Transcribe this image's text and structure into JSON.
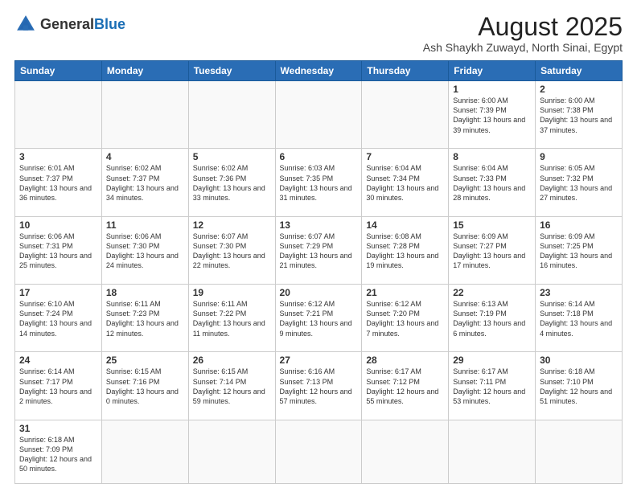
{
  "header": {
    "logo_general": "General",
    "logo_blue": "Blue",
    "title": "August 2025",
    "subtitle": "Ash Shaykh Zuwayd, North Sinai, Egypt"
  },
  "days_of_week": [
    "Sunday",
    "Monday",
    "Tuesday",
    "Wednesday",
    "Thursday",
    "Friday",
    "Saturday"
  ],
  "weeks": [
    [
      {
        "day": "",
        "info": ""
      },
      {
        "day": "",
        "info": ""
      },
      {
        "day": "",
        "info": ""
      },
      {
        "day": "",
        "info": ""
      },
      {
        "day": "",
        "info": ""
      },
      {
        "day": "1",
        "info": "Sunrise: 6:00 AM\nSunset: 7:39 PM\nDaylight: 13 hours and 39 minutes."
      },
      {
        "day": "2",
        "info": "Sunrise: 6:00 AM\nSunset: 7:38 PM\nDaylight: 13 hours and 37 minutes."
      }
    ],
    [
      {
        "day": "3",
        "info": "Sunrise: 6:01 AM\nSunset: 7:37 PM\nDaylight: 13 hours and 36 minutes."
      },
      {
        "day": "4",
        "info": "Sunrise: 6:02 AM\nSunset: 7:37 PM\nDaylight: 13 hours and 34 minutes."
      },
      {
        "day": "5",
        "info": "Sunrise: 6:02 AM\nSunset: 7:36 PM\nDaylight: 13 hours and 33 minutes."
      },
      {
        "day": "6",
        "info": "Sunrise: 6:03 AM\nSunset: 7:35 PM\nDaylight: 13 hours and 31 minutes."
      },
      {
        "day": "7",
        "info": "Sunrise: 6:04 AM\nSunset: 7:34 PM\nDaylight: 13 hours and 30 minutes."
      },
      {
        "day": "8",
        "info": "Sunrise: 6:04 AM\nSunset: 7:33 PM\nDaylight: 13 hours and 28 minutes."
      },
      {
        "day": "9",
        "info": "Sunrise: 6:05 AM\nSunset: 7:32 PM\nDaylight: 13 hours and 27 minutes."
      }
    ],
    [
      {
        "day": "10",
        "info": "Sunrise: 6:06 AM\nSunset: 7:31 PM\nDaylight: 13 hours and 25 minutes."
      },
      {
        "day": "11",
        "info": "Sunrise: 6:06 AM\nSunset: 7:30 PM\nDaylight: 13 hours and 24 minutes."
      },
      {
        "day": "12",
        "info": "Sunrise: 6:07 AM\nSunset: 7:30 PM\nDaylight: 13 hours and 22 minutes."
      },
      {
        "day": "13",
        "info": "Sunrise: 6:07 AM\nSunset: 7:29 PM\nDaylight: 13 hours and 21 minutes."
      },
      {
        "day": "14",
        "info": "Sunrise: 6:08 AM\nSunset: 7:28 PM\nDaylight: 13 hours and 19 minutes."
      },
      {
        "day": "15",
        "info": "Sunrise: 6:09 AM\nSunset: 7:27 PM\nDaylight: 13 hours and 17 minutes."
      },
      {
        "day": "16",
        "info": "Sunrise: 6:09 AM\nSunset: 7:25 PM\nDaylight: 13 hours and 16 minutes."
      }
    ],
    [
      {
        "day": "17",
        "info": "Sunrise: 6:10 AM\nSunset: 7:24 PM\nDaylight: 13 hours and 14 minutes."
      },
      {
        "day": "18",
        "info": "Sunrise: 6:11 AM\nSunset: 7:23 PM\nDaylight: 13 hours and 12 minutes."
      },
      {
        "day": "19",
        "info": "Sunrise: 6:11 AM\nSunset: 7:22 PM\nDaylight: 13 hours and 11 minutes."
      },
      {
        "day": "20",
        "info": "Sunrise: 6:12 AM\nSunset: 7:21 PM\nDaylight: 13 hours and 9 minutes."
      },
      {
        "day": "21",
        "info": "Sunrise: 6:12 AM\nSunset: 7:20 PM\nDaylight: 13 hours and 7 minutes."
      },
      {
        "day": "22",
        "info": "Sunrise: 6:13 AM\nSunset: 7:19 PM\nDaylight: 13 hours and 6 minutes."
      },
      {
        "day": "23",
        "info": "Sunrise: 6:14 AM\nSunset: 7:18 PM\nDaylight: 13 hours and 4 minutes."
      }
    ],
    [
      {
        "day": "24",
        "info": "Sunrise: 6:14 AM\nSunset: 7:17 PM\nDaylight: 13 hours and 2 minutes."
      },
      {
        "day": "25",
        "info": "Sunrise: 6:15 AM\nSunset: 7:16 PM\nDaylight: 13 hours and 0 minutes."
      },
      {
        "day": "26",
        "info": "Sunrise: 6:15 AM\nSunset: 7:14 PM\nDaylight: 12 hours and 59 minutes."
      },
      {
        "day": "27",
        "info": "Sunrise: 6:16 AM\nSunset: 7:13 PM\nDaylight: 12 hours and 57 minutes."
      },
      {
        "day": "28",
        "info": "Sunrise: 6:17 AM\nSunset: 7:12 PM\nDaylight: 12 hours and 55 minutes."
      },
      {
        "day": "29",
        "info": "Sunrise: 6:17 AM\nSunset: 7:11 PM\nDaylight: 12 hours and 53 minutes."
      },
      {
        "day": "30",
        "info": "Sunrise: 6:18 AM\nSunset: 7:10 PM\nDaylight: 12 hours and 51 minutes."
      }
    ],
    [
      {
        "day": "31",
        "info": "Sunrise: 6:18 AM\nSunset: 7:09 PM\nDaylight: 12 hours and 50 minutes."
      },
      {
        "day": "",
        "info": ""
      },
      {
        "day": "",
        "info": ""
      },
      {
        "day": "",
        "info": ""
      },
      {
        "day": "",
        "info": ""
      },
      {
        "day": "",
        "info": ""
      },
      {
        "day": "",
        "info": ""
      }
    ]
  ]
}
